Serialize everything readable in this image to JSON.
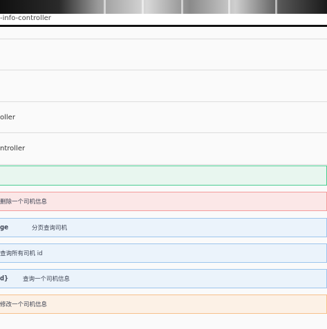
{
  "browser": {
    "url_fragment": "-info-controller"
  },
  "controllers": [
    {
      "label": ""
    },
    {
      "label": ""
    },
    {
      "label": ""
    },
    {
      "label": "oller"
    },
    {
      "label": "ntroller"
    }
  ],
  "operations": [
    {
      "method": "post",
      "path": "",
      "summary": ""
    },
    {
      "method": "delete",
      "path": "",
      "summary": "删除一个司机信息"
    },
    {
      "method": "get",
      "path": "ge",
      "summary": "分页查询司机"
    },
    {
      "method": "get",
      "path": "",
      "summary": "查询所有司机 id"
    },
    {
      "method": "get",
      "path": "d}",
      "summary": "查询一个司机信息"
    },
    {
      "method": "put",
      "path": "",
      "summary": "修改一个司机信息"
    }
  ],
  "colors": {
    "post_bg": "#e8f6ef",
    "delete_bg": "#fbe7e7",
    "get_bg": "#ebf3fb",
    "put_bg": "#fcf1e6"
  }
}
